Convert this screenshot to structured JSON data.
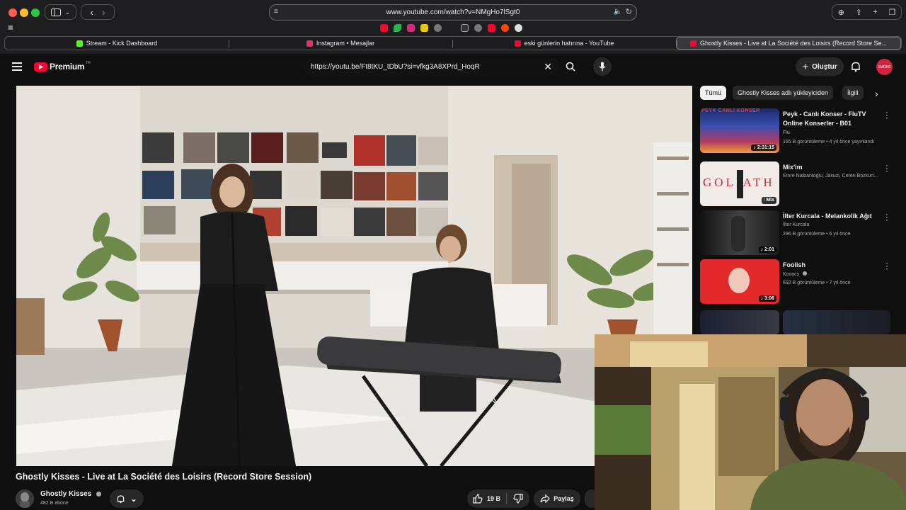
{
  "browser": {
    "url": "www.youtube.com/watch?v=NMgHo7lSgt0",
    "tabs": [
      {
        "label": "Stream - Kick Dashboard",
        "color": "#53fc18"
      },
      {
        "label": "Instagram • Mesajlar",
        "color": "#e1306c"
      },
      {
        "label": "eski günlerin hatırına - YouTube",
        "color": "#ff0033"
      },
      {
        "label": "Ghostly Kisses - Live at La Société des Loisirs (Record Store Se...",
        "color": "#ff0033"
      }
    ]
  },
  "youtube": {
    "logo_text": "Premium",
    "logo_region": "TR",
    "search_value": "https://youtu.be/Ft8tKU_tDbU?si=vfkg3A8XPrd_HoqR",
    "create_label": "Oluştur",
    "avatar_text": "SMOKE"
  },
  "video": {
    "title": "Ghostly Kisses - Live at La Société des Loisirs (Record Store Session)",
    "channel": "Ghostly Kisses",
    "subscribers": "482 B abone",
    "likes": "19 B",
    "share_label": "Paylaş"
  },
  "sidebar": {
    "chips": [
      "Tümü",
      "Ghostly Kisses adlı yükleyiciden",
      "İlgili"
    ],
    "recommendations": [
      {
        "title": "Peyk - Canlı Konser - FluTV Online Konserler - B01",
        "channel": "Flu",
        "meta": "165 B görüntüleme • 4 yıl önce yayınlandı",
        "duration": "2:31:15",
        "thumb_text": "PEYK CANLI KONSER"
      },
      {
        "title": "Mix'im",
        "channel": "Emre Nalbantoğlu, Jakuzi, Ceren Bozkurt...",
        "meta": "",
        "duration": "Mix",
        "thumb_text": "GOLIATH"
      },
      {
        "title": "İlter Kurcala - Melankolik Ağıt",
        "channel": "İlter Kurcala",
        "meta": "296 B görüntüleme • 6 yıl önce",
        "duration": "2:01",
        "thumb_text": ""
      },
      {
        "title": "Foolish",
        "channel": "Kovacs",
        "meta": "692 B görüntüleme • 7 yıl önce",
        "duration": "3:06",
        "thumb_text": ""
      }
    ]
  }
}
